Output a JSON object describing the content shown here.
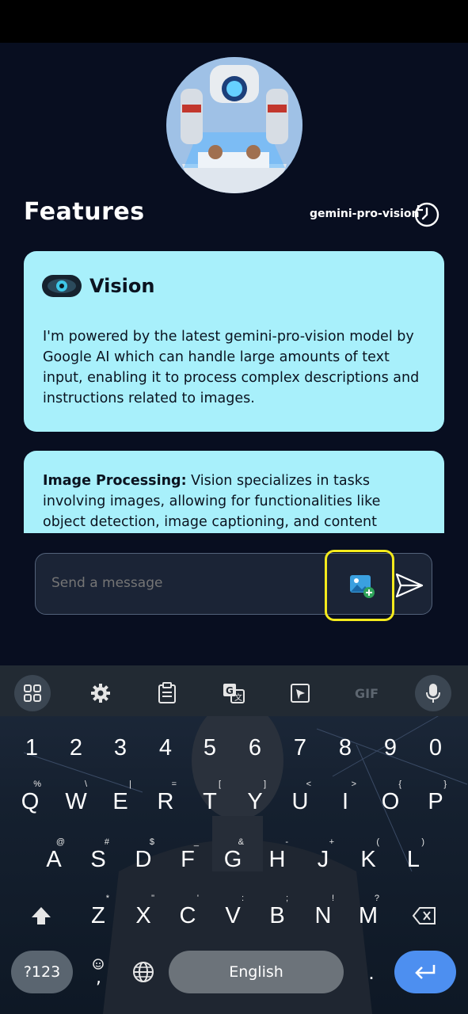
{
  "header": {
    "features_title": "Features",
    "model_name": "gemini-pro-vision",
    "history_icon": "history-icon"
  },
  "cards": [
    {
      "title": "Vision",
      "icon": "eye-icon",
      "text": "I'm powered by the latest gemini-pro-vision model by Google AI which can handle large amounts of text input, enabling it to process complex descriptions and instructions related to images."
    },
    {
      "bold_lead": "Image Processing:",
      "text": " Vision specializes in tasks involving images, allowing for functionalities like object detection, image captioning, and content generation"
    }
  ],
  "composer": {
    "placeholder": "Send a message",
    "image_button_icon": "add-image-icon",
    "send_icon": "send-icon"
  },
  "keyboard": {
    "toolbar": [
      "apps-grid-icon",
      "settings-gear-icon",
      "clipboard-icon",
      "translate-icon",
      "screenshot-icon",
      "GIF",
      "microphone-icon"
    ],
    "gif_label": "GIF",
    "numbers": [
      "1",
      "2",
      "3",
      "4",
      "5",
      "6",
      "7",
      "8",
      "9",
      "0"
    ],
    "row1": [
      {
        "k": "Q",
        "h": "%"
      },
      {
        "k": "W",
        "h": "\\"
      },
      {
        "k": "E",
        "h": "|"
      },
      {
        "k": "R",
        "h": "="
      },
      {
        "k": "T",
        "h": "["
      },
      {
        "k": "Y",
        "h": "]"
      },
      {
        "k": "U",
        "h": "<"
      },
      {
        "k": "I",
        "h": ">"
      },
      {
        "k": "O",
        "h": "{"
      },
      {
        "k": "P",
        "h": "}"
      }
    ],
    "row2": [
      {
        "k": "A",
        "h": "@"
      },
      {
        "k": "S",
        "h": "#"
      },
      {
        "k": "D",
        "h": "$"
      },
      {
        "k": "F",
        "h": "_"
      },
      {
        "k": "G",
        "h": "&"
      },
      {
        "k": "H",
        "h": "-"
      },
      {
        "k": "J",
        "h": "+"
      },
      {
        "k": "K",
        "h": "("
      },
      {
        "k": "L",
        "h": ")"
      }
    ],
    "row3": [
      {
        "k": "Z",
        "h": "*"
      },
      {
        "k": "X",
        "h": "\""
      },
      {
        "k": "C",
        "h": "'"
      },
      {
        "k": "V",
        "h": ":"
      },
      {
        "k": "B",
        "h": ";"
      },
      {
        "k": "N",
        "h": "!"
      },
      {
        "k": "M",
        "h": "?"
      }
    ],
    "symbols_label": "?123",
    "emoji_icon": "emoji-icon",
    "globe_icon": "globe-icon",
    "space_label": "English",
    "enter_icon": "enter-icon",
    "shift_icon": "shift-icon",
    "backspace_icon": "backspace-icon"
  }
}
